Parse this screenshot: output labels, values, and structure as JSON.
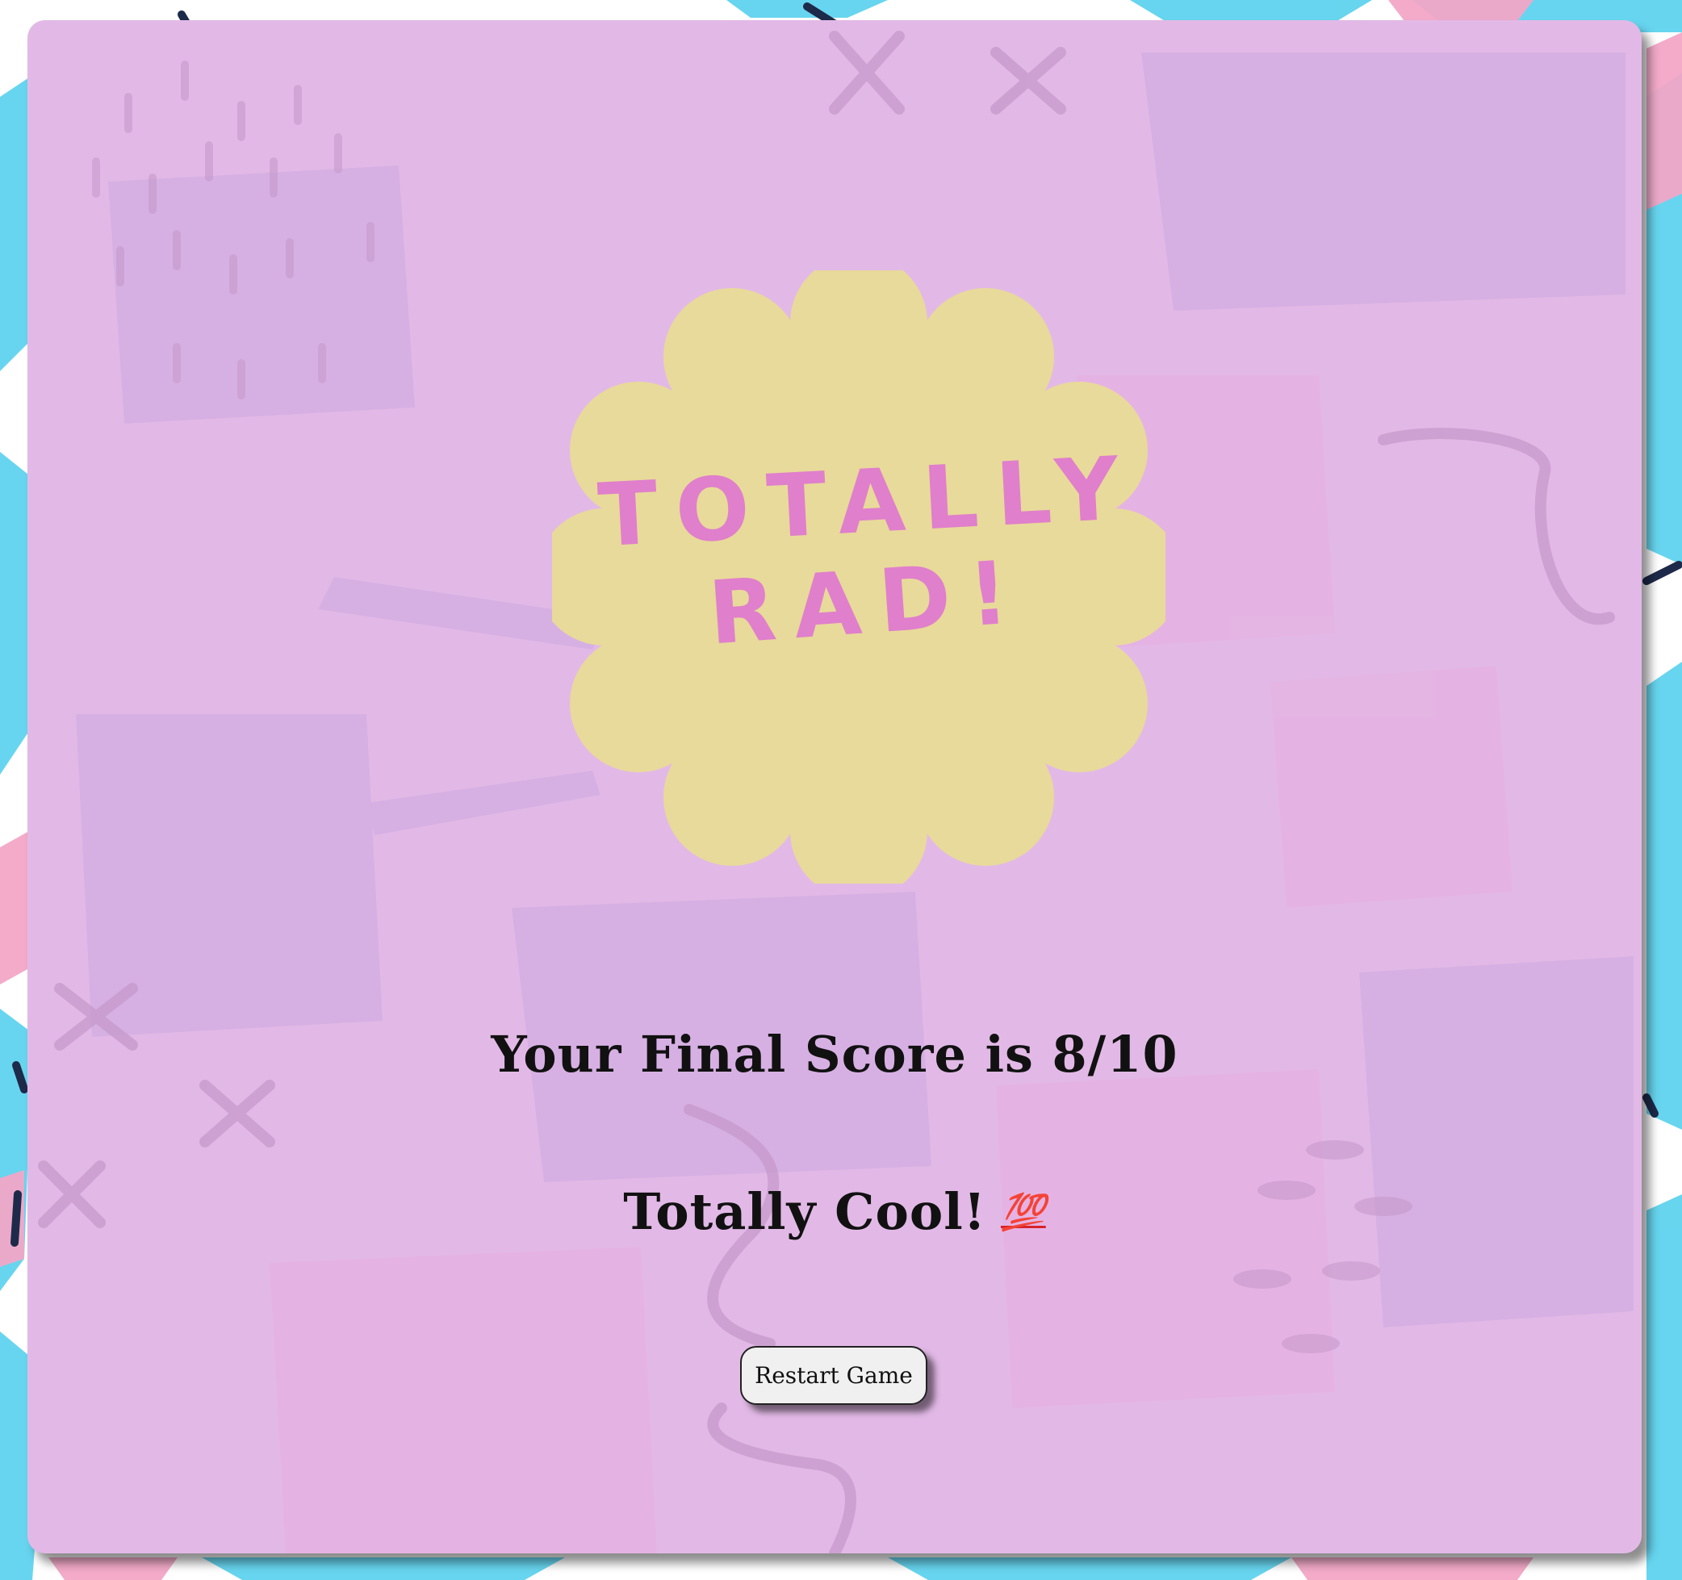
{
  "badge": {
    "line1": "TOTALLY",
    "line2": "RAD!",
    "fill_color": "#e8da9a",
    "text_color": "#e07fcc"
  },
  "result": {
    "score_text": "Your Final Score is 8/10",
    "comment_text": "Totally Cool!",
    "comment_emoji": "💯"
  },
  "restart_button": {
    "label": "Restart Game"
  },
  "colors": {
    "card_background": "#e2b9e6",
    "page_splash_blue": "#5fd3ee",
    "page_splash_pink": "#f2a7c6",
    "page_splash_navy": "#1e2a4a"
  }
}
